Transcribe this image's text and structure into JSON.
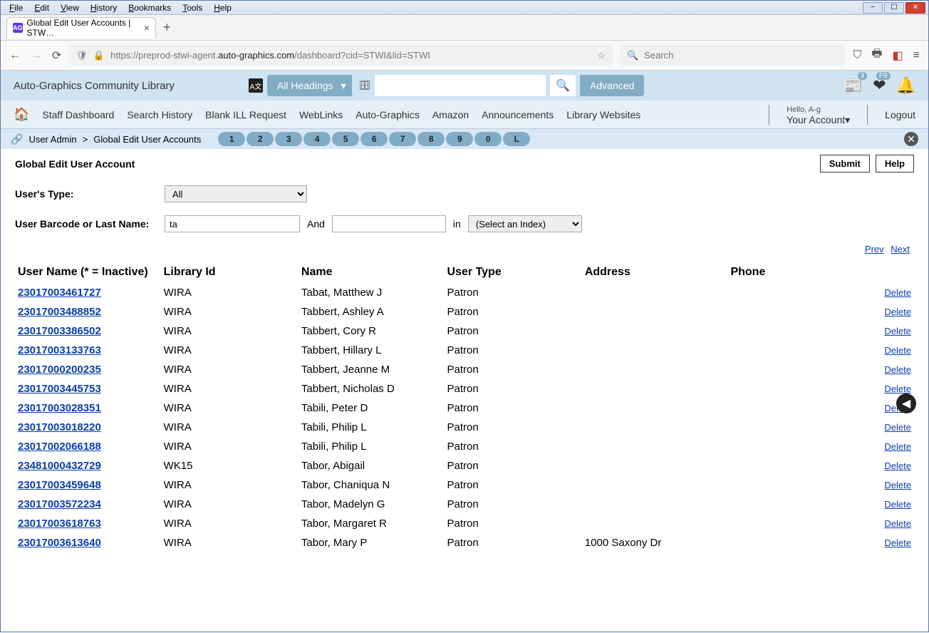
{
  "menubar": [
    "File",
    "Edit",
    "View",
    "History",
    "Bookmarks",
    "Tools",
    "Help"
  ],
  "window_controls": {
    "min": "−",
    "max": "☐",
    "close": "✕"
  },
  "tab": {
    "title": "Global Edit User Accounts | STW…",
    "favicon": "AG"
  },
  "url": {
    "shield": "🛡",
    "lock": "🔒",
    "pre": "https://preprod-stwi-agent.",
    "domain": "auto-graphics.com",
    "path": "/dashboard?cid=STWI&lid=STWI",
    "star": "☆"
  },
  "browser_search_placeholder": "Search",
  "header": {
    "library": "Auto-Graphics Community Library",
    "headings_label": "All Headings",
    "advanced": "Advanced",
    "badge1": "3",
    "badge2": "F9"
  },
  "nav": {
    "items": [
      "Staff Dashboard",
      "Search History",
      "Blank ILL Request",
      "WebLinks",
      "Auto-Graphics",
      "Amazon",
      "Announcements",
      "Library Websites"
    ],
    "hello": "Hello, A-g",
    "account": "Your Account▾",
    "logout": "Logout"
  },
  "breadcrumb": {
    "a": "User Admin",
    "sep": ">",
    "b": "Global Edit User Accounts",
    "pills": [
      "1",
      "2",
      "3",
      "4",
      "5",
      "6",
      "7",
      "8",
      "9",
      "0",
      "L"
    ]
  },
  "panel": {
    "title": "Global Edit User Account",
    "submit": "Submit",
    "help": "Help",
    "type_label": "User's Type:",
    "type_value": "All",
    "barcode_label": "User Barcode or Last Name:",
    "barcode_value": "ta",
    "and": "And",
    "in": "in",
    "index_value": "(Select an Index)",
    "prev": "Prev",
    "next": "Next"
  },
  "columns": [
    "User Name (* = Inactive)",
    "Library Id",
    "Name",
    "User Type",
    "Address",
    "Phone",
    ""
  ],
  "delete_label": "Delete",
  "rows": [
    {
      "id": "23017003461727",
      "lib": "WIRA",
      "name": "Tabat, Matthew J",
      "type": "Patron",
      "addr": "",
      "phone": ""
    },
    {
      "id": "23017003488852",
      "lib": "WIRA",
      "name": "Tabbert, Ashley A",
      "type": "Patron",
      "addr": "",
      "phone": ""
    },
    {
      "id": "23017003386502",
      "lib": "WIRA",
      "name": "Tabbert, Cory R",
      "type": "Patron",
      "addr": "",
      "phone": ""
    },
    {
      "id": "23017003133763",
      "lib": "WIRA",
      "name": "Tabbert, Hillary L",
      "type": "Patron",
      "addr": "",
      "phone": ""
    },
    {
      "id": "23017000200235",
      "lib": "WIRA",
      "name": "Tabbert, Jeanne M",
      "type": "Patron",
      "addr": "",
      "phone": ""
    },
    {
      "id": "23017003445753",
      "lib": "WIRA",
      "name": "Tabbert, Nicholas D",
      "type": "Patron",
      "addr": "",
      "phone": ""
    },
    {
      "id": "23017003028351",
      "lib": "WIRA",
      "name": "Tabili, Peter D",
      "type": "Patron",
      "addr": "",
      "phone": ""
    },
    {
      "id": "23017003018220",
      "lib": "WIRA",
      "name": "Tabili, Philip L",
      "type": "Patron",
      "addr": "",
      "phone": ""
    },
    {
      "id": "23017002066188",
      "lib": "WIRA",
      "name": "Tabili, Philip L",
      "type": "Patron",
      "addr": "",
      "phone": ""
    },
    {
      "id": "23481000432729",
      "lib": "WK15",
      "name": "Tabor, Abigail",
      "type": "Patron",
      "addr": "",
      "phone": ""
    },
    {
      "id": "23017003459648",
      "lib": "WIRA",
      "name": "Tabor, Chaniqua N",
      "type": "Patron",
      "addr": "",
      "phone": ""
    },
    {
      "id": "23017003572234",
      "lib": "WIRA",
      "name": "Tabor, Madelyn G",
      "type": "Patron",
      "addr": "",
      "phone": ""
    },
    {
      "id": "23017003618763",
      "lib": "WIRA",
      "name": "Tabor, Margaret R",
      "type": "Patron",
      "addr": "",
      "phone": ""
    },
    {
      "id": "23017003613640",
      "lib": "WIRA",
      "name": "Tabor, Mary P",
      "type": "Patron",
      "addr": "1000 Saxony Dr",
      "phone": ""
    }
  ]
}
